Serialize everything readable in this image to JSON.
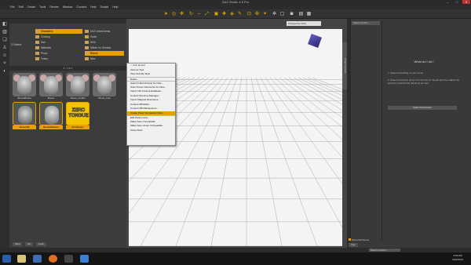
{
  "window": {
    "title": "DAZ Studio 4.6 Pro",
    "minimize": "–",
    "maximize": "□",
    "close": "✕"
  },
  "menubar": [
    "File",
    "Edit",
    "Create",
    "Tools",
    "Render",
    "Window",
    "Connect",
    "Help",
    "Scripts",
    "Help"
  ],
  "content_library": {
    "nav_left": [
      "",
      "",
      "2 Folders"
    ],
    "nav_mid": [
      {
        "label": "Characters",
        "selected": true
      },
      {
        "label": "Clothing",
        "selected": false
      },
      {
        "label": "Hair",
        "selected": false
      },
      {
        "label": "Materials",
        "selected": false
      },
      {
        "label": "Props",
        "selected": false
      },
      {
        "label": "Poses",
        "selected": false
      }
    ],
    "nav_right": [
      {
        "label": "DAZ Unreal Ideas",
        "selected": false
      },
      {
        "label": "Gwen",
        "selected": false
      },
      {
        "label": "HDLI",
        "selected": false
      },
      {
        "label": "Hiltner for Genesis",
        "selected": false
      },
      {
        "label": "Mouse",
        "selected": true
      },
      {
        "label": "Misc",
        "selected": false
      }
    ],
    "page_indicator": "1 - 7 of 7",
    "thumbs": [
      {
        "label": "!MouseBodies",
        "selected": false
      },
      {
        "label": "Mouse",
        "selected": false
      },
      {
        "label": "Mouse_Cuddle",
        "selected": false
      },
      {
        "label": "Mouse_Cute",
        "selected": false
      },
      {
        "label": "MouseTail",
        "selected": true
      },
      {
        "label": "MouseWhiskers",
        "selected": true
      },
      {
        "label": "ZeroTongue",
        "selected": true
      }
    ],
    "zero_tongue_text": "ZERO\nTONGUE",
    "bottom_tabs": [
      "Files",
      "Lib",
      "Look"
    ]
  },
  "viewport": {
    "camera": "Perspective View",
    "vertical_tab": "Smart Content"
  },
  "context_menu": [
    {
      "label": "Icon as List",
      "checked": true
    },
    {
      "label": "View as Tree",
      "checked": false
    },
    {
      "label": "View Sets By Style",
      "checked": false
    },
    {
      "label": "Delete",
      "checked": false
    },
    {
      "label": "Search Hard Drive(s) for Files...",
      "checked": false
    },
    {
      "label": "Scan Known Directories for Files...",
      "checked": false
    },
    {
      "label": "Import Old Content Database...",
      "checked": false
    },
    {
      "label": "Content Directory Manager...",
      "checked": false
    },
    {
      "label": "Import Mapped Directories...",
      "checked": false
    },
    {
      "label": "Content DB Editor...",
      "checked": false
    },
    {
      "label": "Content DB Maintenance...",
      "checked": false
    },
    {
      "label": "Create Poser Companion Files...",
      "checked": false,
      "highlight": true
    },
    {
      "label": "Edit Preferences...",
      "checked": false
    },
    {
      "label": "Make Face Uncreatable",
      "checked": false
    },
    {
      "label": "Make Face Group Uncreatable",
      "checked": false
    },
    {
      "label": "Close Parts",
      "checked": false
    }
  ],
  "right_panel": {
    "search_placeholder": "Select an item...",
    "heading": "What do I do?",
    "step1": "1. Select something in your scene",
    "step2": "2. Select a property group from the list on the left and then adjust the property controls that will show up here",
    "button": "Static Parameters",
    "show_sub_items": "Show Sub Items",
    "bottom_tab": "Tips",
    "lesson_placeholder": "Select a Lesson..."
  },
  "taskbar": {
    "time": "3:55 PM",
    "date": "9/22/2013"
  }
}
